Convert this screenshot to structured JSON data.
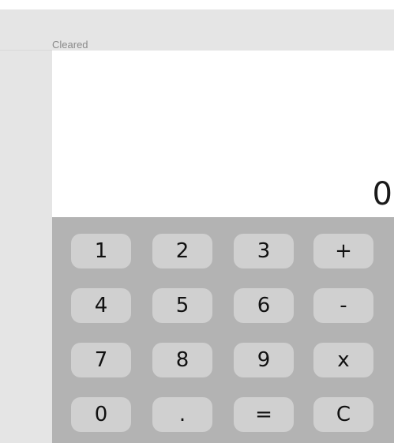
{
  "status_text": "Cleared",
  "display": {
    "value": "0"
  },
  "keypad": {
    "rows": [
      [
        "1",
        "2",
        "3",
        "+"
      ],
      [
        "4",
        "5",
        "6",
        "-"
      ],
      [
        "7",
        "8",
        "9",
        "x"
      ],
      [
        "0",
        ".",
        "=",
        "C"
      ]
    ]
  },
  "colors": {
    "background": "#ffffff",
    "sidebar": "#e5e5e5",
    "keypad": "#b3b3b3",
    "key": "#d0d0d0",
    "text": "#111111",
    "status": "#8a8a8a"
  }
}
